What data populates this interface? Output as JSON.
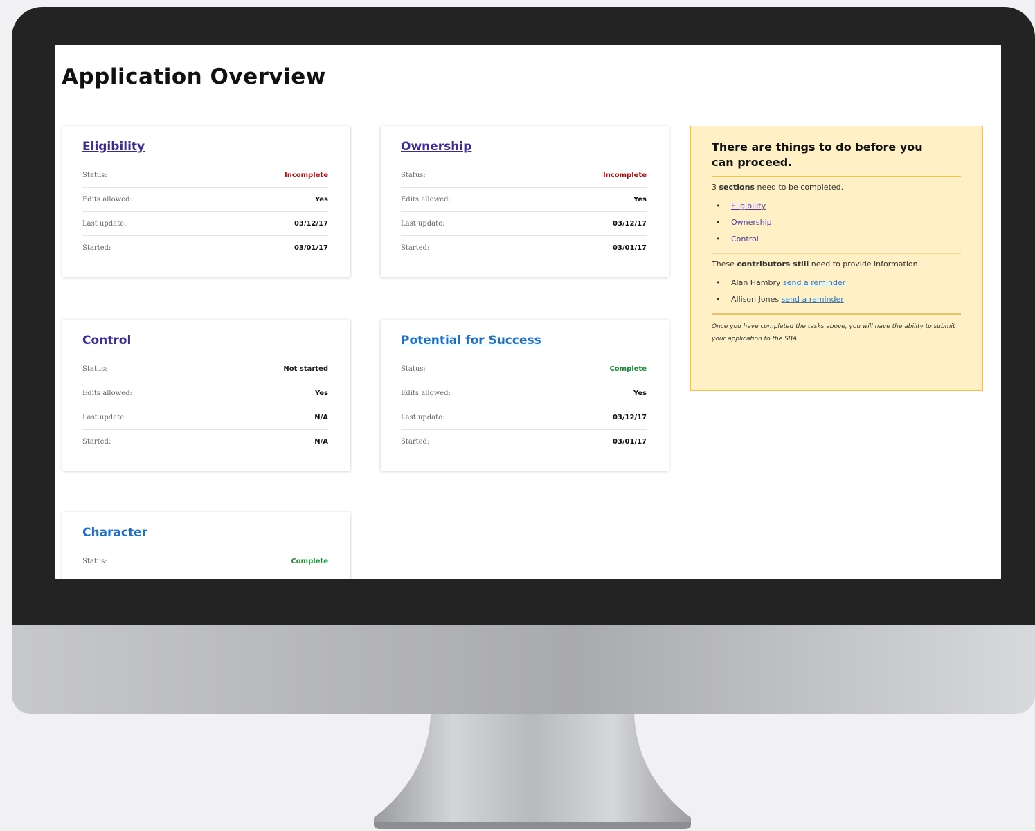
{
  "page": {
    "title": "Application Overview"
  },
  "cards": [
    {
      "title": "Eligibility",
      "rows": [
        {
          "label": "Status:",
          "value": "Incomplete"
        },
        {
          "label": "Edits allowed:",
          "value": "Yes"
        },
        {
          "label": "Last update:",
          "value": "03/12/17"
        },
        {
          "label": "Started:",
          "value": "03/01/17"
        }
      ]
    },
    {
      "title": "Ownership",
      "rows": [
        {
          "label": "Status:",
          "value": "Incomplete"
        },
        {
          "label": "Edits allowed:",
          "value": "Yes"
        },
        {
          "label": "Last update:",
          "value": "03/12/17"
        },
        {
          "label": "Started:",
          "value": "03/01/17"
        }
      ]
    },
    {
      "title": "Control",
      "rows": [
        {
          "label": "Status:",
          "value": "Not started"
        },
        {
          "label": "Edits allowed:",
          "value": "Yes"
        },
        {
          "label": "Last update:",
          "value": "N/A"
        },
        {
          "label": "Started:",
          "value": "N/A"
        }
      ]
    },
    {
      "title": "Potential for Success",
      "rows": [
        {
          "label": "Status:",
          "value": "Complete"
        },
        {
          "label": "Edits allowed:",
          "value": "Yes"
        },
        {
          "label": "Last update:",
          "value": "03/12/17"
        },
        {
          "label": "Started:",
          "value": "03/01/17"
        }
      ]
    },
    {
      "title": "Character",
      "rows": [
        {
          "label": "Status:",
          "value": "Complete"
        }
      ]
    }
  ],
  "notice": {
    "heading": "There are things to do before you can proceed.",
    "sections_count": "3",
    "sections_bold": "sections",
    "sections_text": "need to be completed.",
    "sections": [
      "Eligibility",
      "Ownership",
      "Control"
    ],
    "contrib_pre": "These",
    "contrib_bold": "contributors still",
    "contrib_text": "need to provide information.",
    "contributors": [
      {
        "name": "Alan Hambry",
        "link": "send a reminder"
      },
      {
        "name": "Allison Jones",
        "link": "send a reminder"
      }
    ],
    "footer": "Once you have completed the tasks above, you will have the ability to submit your application to the SBA."
  },
  "colors": {
    "incomplete": "#a21414",
    "complete": "#1e8a3a",
    "link": "#3d2b8f",
    "notice_bg": "#fff0c5",
    "notice_border": "#f0c060"
  }
}
